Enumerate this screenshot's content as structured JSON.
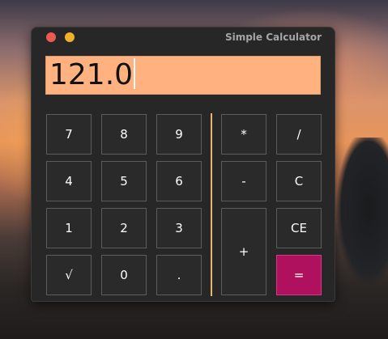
{
  "window": {
    "title": "Simple Calculator"
  },
  "display": {
    "value": "121.0"
  },
  "keypad": {
    "digits": [
      {
        "label": "7",
        "name": "key-7"
      },
      {
        "label": "8",
        "name": "key-8"
      },
      {
        "label": "9",
        "name": "key-9"
      },
      {
        "label": "4",
        "name": "key-4"
      },
      {
        "label": "5",
        "name": "key-5"
      },
      {
        "label": "6",
        "name": "key-6"
      },
      {
        "label": "1",
        "name": "key-1"
      },
      {
        "label": "2",
        "name": "key-2"
      },
      {
        "label": "3",
        "name": "key-3"
      },
      {
        "label": "√",
        "name": "sqrt-button"
      },
      {
        "label": "0",
        "name": "key-0"
      },
      {
        "label": ".",
        "name": "decimal-button"
      }
    ],
    "operators": {
      "multiply": "*",
      "divide": "/",
      "subtract": "-",
      "clear": "C",
      "add": "+",
      "clear_entry": "CE",
      "equals": "="
    }
  },
  "colors": {
    "display_bg": "#ffb27f",
    "equals_bg": "#b0115f",
    "divider": "#e6b86e",
    "close_dot": "#ee5a52",
    "minimize_dot": "#f0b02a"
  }
}
